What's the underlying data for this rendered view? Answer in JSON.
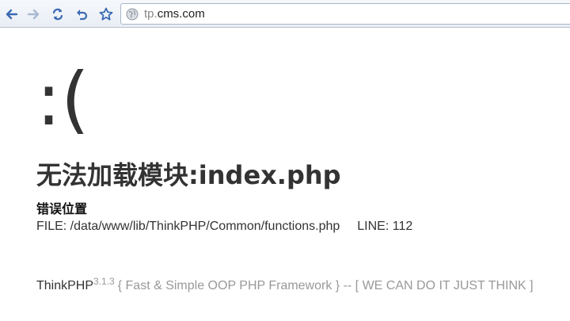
{
  "browser": {
    "url_scheme_part": "tp.",
    "url_host_part": "cms.com",
    "buttons": {
      "back": "back-arrow-icon",
      "forward": "forward-arrow-icon",
      "reload": "reload-icon",
      "undo": "undo-icon",
      "bookmark": "star-icon"
    }
  },
  "error_page": {
    "face": ":(",
    "title": "无法加载模块:index.php",
    "location_heading": "错误位置",
    "file_text": "FILE: /data/www/lib/ThinkPHP/Common/functions.php",
    "line_text": "LINE: 112"
  },
  "footer": {
    "brand": "ThinkPHP",
    "version": "3.1.3",
    "tagline": "{ Fast & Simple OOP PHP Framework } -- [ WE CAN DO IT JUST THINK ]"
  },
  "colors": {
    "toolbar_bg": "#e9eef5",
    "nav_icon": "#3b6bb3",
    "text_dark": "#333333",
    "text_muted": "#999999"
  }
}
